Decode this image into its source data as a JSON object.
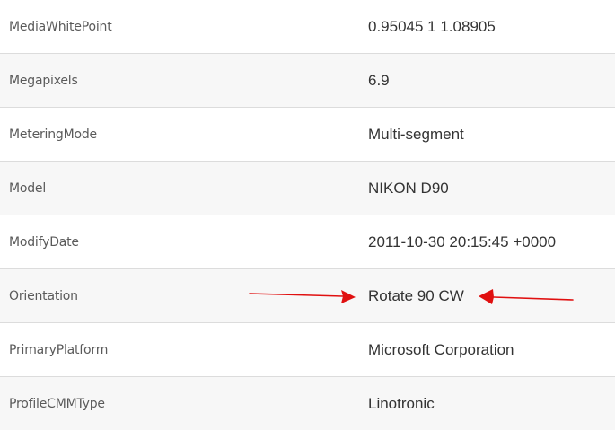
{
  "rows": [
    {
      "key": "MediaWhitePoint",
      "value": "0.95045 1 1.08905"
    },
    {
      "key": "Megapixels",
      "value": "6.9"
    },
    {
      "key": "MeteringMode",
      "value": "Multi-segment"
    },
    {
      "key": "Model",
      "value": "NIKON D90"
    },
    {
      "key": "ModifyDate",
      "value": "2011-10-30 20:15:45 +0000"
    },
    {
      "key": "Orientation",
      "value": "Rotate 90 CW"
    },
    {
      "key": "PrimaryPlatform",
      "value": "Microsoft Corporation"
    },
    {
      "key": "ProfileCMMType",
      "value": "Linotronic"
    }
  ],
  "annotation": {
    "arrow_color": "#e01010",
    "target_row": "Orientation"
  }
}
